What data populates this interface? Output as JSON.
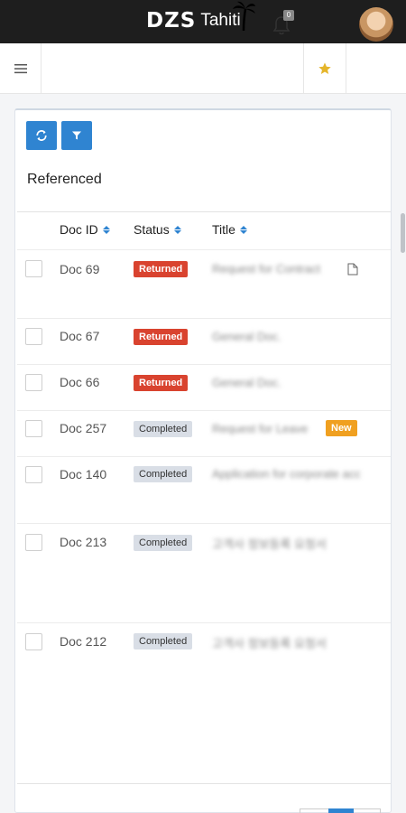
{
  "header": {
    "brand": "DZS",
    "brand_suffix": "Tahiti",
    "notification_count": "0"
  },
  "icons": {
    "menu": "hamburger-icon",
    "notifications": "bell-icon",
    "favorites": "star-icon",
    "refresh": "refresh-icon",
    "filter": "filter-icon",
    "attachment": "document-icon"
  },
  "colors": {
    "accent": "#2f84d1",
    "returned": "#d9432f",
    "completed": "#d9dee6",
    "new": "#f0a020",
    "star": "#e5b52a"
  },
  "section": {
    "title": "Referenced"
  },
  "table": {
    "columns": [
      "Doc ID",
      "Status",
      "Title"
    ],
    "rows": [
      {
        "doc_id": "Doc 69",
        "status": "Returned",
        "title": "Request for Contract"
      },
      {
        "doc_id": "Doc 67",
        "status": "Returned",
        "title": "General Doc."
      },
      {
        "doc_id": "Doc 66",
        "status": "Returned",
        "title": "General Doc."
      },
      {
        "doc_id": "Doc 257",
        "status": "Completed",
        "title": "Request for Leave",
        "tag": "New"
      },
      {
        "doc_id": "Doc 140",
        "status": "Completed",
        "title": "Application for corporate acc"
      },
      {
        "doc_id": "Doc 213",
        "status": "Completed",
        "title": "고객사 정보등록 요청서"
      },
      {
        "doc_id": "Doc 212",
        "status": "Completed",
        "title": "고객사 정보등록 요청서"
      }
    ]
  }
}
